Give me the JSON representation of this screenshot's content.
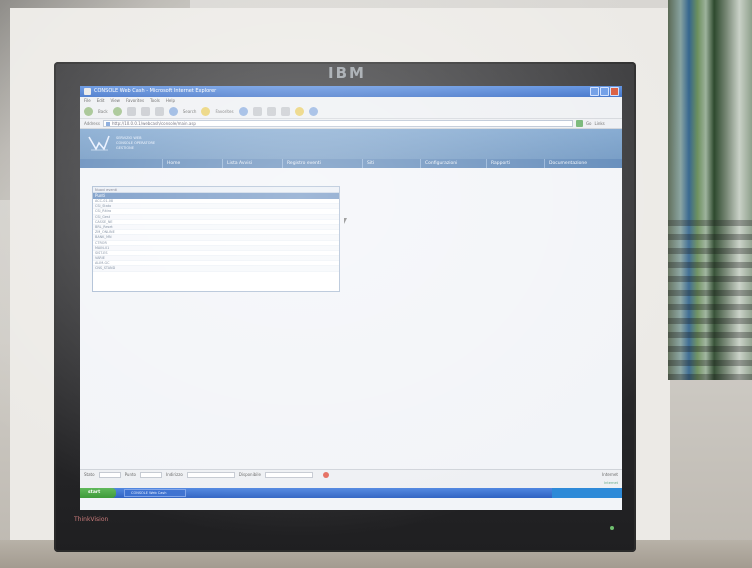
{
  "monitor": {
    "brand_logo": "IBM",
    "bezel_brand": "ThinkVision"
  },
  "window": {
    "title": "CONSOLE Web Cash - Microsoft Internet Explorer"
  },
  "menu": [
    "File",
    "Edit",
    "View",
    "Favorites",
    "Tools",
    "Help"
  ],
  "toolbar": {
    "back": "Back",
    "search": "Search",
    "favorites": "Favorites"
  },
  "address": {
    "label": "Address",
    "value": "http://10.0.0.1/webcash/console/main.asp",
    "go": "Go",
    "links": "Links"
  },
  "banner": {
    "line1": "SERVIZIO WEB",
    "line2": "CONSOLE OPERATORE",
    "line3": "GESTIONE"
  },
  "nav": [
    "Home",
    "Lista Avvisi",
    "Registro eventi",
    "Siti",
    "Configurazioni",
    "Rapporti",
    "Documentazione"
  ],
  "panel": {
    "header": "Nuovi eventi",
    "selected": "Punti",
    "rows": [
      "ACC-01-08",
      "CSI_Stato",
      "CSI_Ritiro",
      "CSI_Gest",
      "CASSE_NE",
      "BRL_Reset",
      "ZM_ONLINE",
      "BANK_MN",
      "CTROR",
      "MAIN-01",
      "SIST-ES",
      "VARIE",
      "ALIM-GC",
      "CNS_STAND"
    ]
  },
  "statusbar": {
    "label1": "Stato",
    "label2": "Punto",
    "label3": "Indirizzo",
    "label4": "Disponibile",
    "right": "Internet"
  },
  "taskbar": {
    "start": "start",
    "task": "CONSOLE Web Cash"
  }
}
